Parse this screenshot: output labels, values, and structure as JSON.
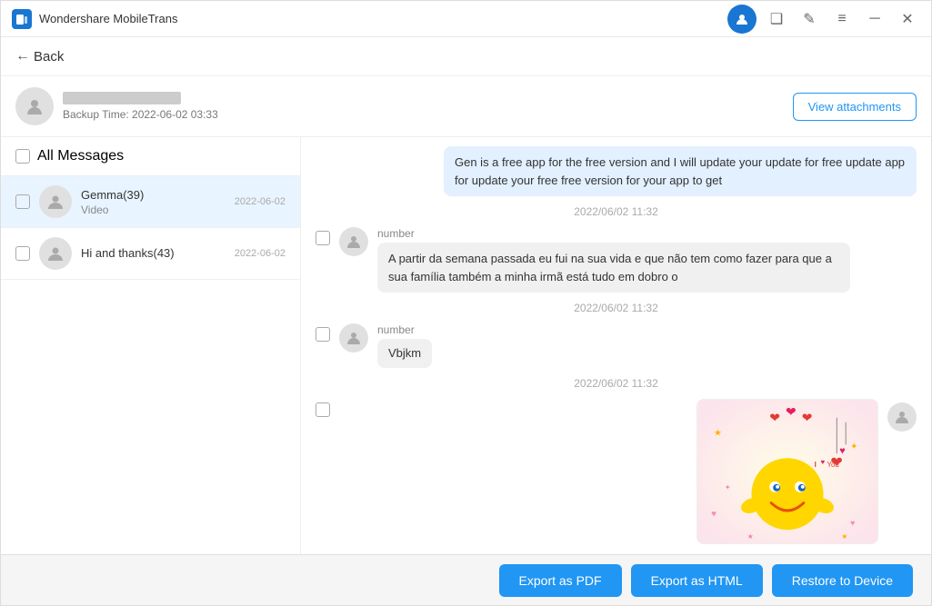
{
  "app": {
    "title": "Wondershare MobileTrans",
    "icon": "mobile-trans-icon"
  },
  "window_controls": {
    "profile_btn": "profile-button",
    "minimize": "─",
    "maximize": "❑",
    "edit": "✎",
    "menu": "≡",
    "close": "✕"
  },
  "header": {
    "back_label": "Back"
  },
  "profile": {
    "name_placeholder": "████████████",
    "backup_time": "Backup Time: 2022-06-02 03:33",
    "view_attachments": "View attachments"
  },
  "left_panel": {
    "all_messages_label": "All Messages",
    "conversations": [
      {
        "name": "Gemma(39)",
        "preview": "Video",
        "date": "2022-06-02",
        "active": true
      },
      {
        "name": "Hi and thanks(43)",
        "preview": "",
        "date": "2022-06-02",
        "active": false
      }
    ]
  },
  "messages": [
    {
      "type": "sent",
      "text": "Gen is a free app for the free version and I will update your update for free update app for update your free free version for your app to get",
      "timestamp": null,
      "sender": null
    },
    {
      "type": "timestamp",
      "value": "2022/06/02 11:32"
    },
    {
      "type": "received",
      "sender": "number",
      "text": "A partir da semana passada eu fui na sua vida e que não tem como fazer para que a sua família também a minha irmã está tudo em dobro o",
      "timestamp": null
    },
    {
      "type": "timestamp",
      "value": "2022/06/02 11:32"
    },
    {
      "type": "received",
      "sender": "number",
      "text": "Vbjkm",
      "timestamp": null
    },
    {
      "type": "timestamp",
      "value": "2022/06/02 11:32"
    },
    {
      "type": "image",
      "sender": null,
      "description": "Valentine sticker with hearts and emoji"
    }
  ],
  "footer": {
    "export_pdf": "Export as PDF",
    "export_html": "Export as HTML",
    "restore": "Restore to Device"
  }
}
